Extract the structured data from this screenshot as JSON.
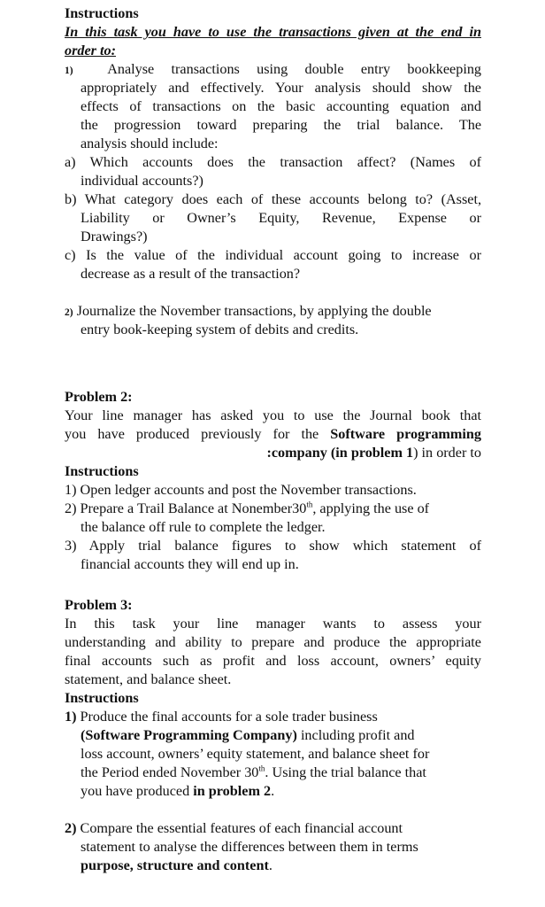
{
  "problem1": {
    "heading": "Instructions",
    "intro_line1": "In this task you have to use the transactions given at the end in",
    "intro_line2": "order to:",
    "item1": {
      "num": "1)",
      "lines": [
        "Analyse transactions using double entry bookkeeping",
        "appropriately and effectively. Your analysis should show the",
        "effects of transactions on the basic accounting equation and",
        "the progression toward preparing the trial balance. The",
        "analysis should include:"
      ]
    },
    "sub_a": [
      "a) Which accounts does the transaction affect? (Names of",
      "individual accounts?)"
    ],
    "sub_b": [
      "b) What category does each of these accounts belong to? (Asset,",
      "Liability or Owner’s Equity, Revenue, Expense or",
      "Drawings?)"
    ],
    "sub_c": [
      "c) Is the value of the individual account going to increase or",
      "decrease as a result of the transaction?"
    ],
    "item2": {
      "num": "2)",
      "lines": [
        "Journalize the November transactions, by applying the double",
        "entry book-keeping system of debits and credits."
      ]
    }
  },
  "problem2": {
    "heading": "Problem 2:",
    "para_line1": "Your line manager has asked you to use the Journal book that",
    "para_line2_pre": "you have produced previously for the ",
    "para_line2_bold": "Software programming",
    "para_line3_bold": ":company (in problem 1",
    "para_line3_post": ") in order to",
    "instructions_heading": "Instructions",
    "item1": "1) Open ledger accounts and post the November transactions.",
    "item2_pre": "2) Prepare a Trail Balance at Nonember30",
    "item2_sup": "th",
    "item2_post": ", applying the use of",
    "item2_line2": "the balance off rule to complete the ledger.",
    "item3_line1": "3) Apply trial balance figures to show which statement of",
    "item3_line2": "financial accounts they will end up in."
  },
  "problem3": {
    "heading": "Problem 3:",
    "para": [
      "In this task your line manager wants to assess your",
      "understanding and ability to prepare and produce the appropriate",
      "final accounts such as profit and loss account, owners’ equity",
      "statement, and balance sheet."
    ],
    "instructions_heading": "Instructions",
    "item1_num": "1)",
    "item1_line1": " Produce the final accounts for a sole trader business",
    "item1_line2_bold": "(Software Programming Company)",
    "item1_line2_post": " including profit and",
    "item1_line3": "loss account, owners’ equity statement, and balance sheet for",
    "item1_line4_pre": "the Period ended November 30",
    "item1_line4_sup": "th",
    "item1_line4_post": ". Using the trial balance that",
    "item1_line5_pre": "you have produced ",
    "item1_line5_bold": "in problem 2",
    "item1_line5_post": ".",
    "item2_num": "2)",
    "item2_line1": " Compare the essential features of each financial account",
    "item2_line2": "statement to analyse the differences between them in terms",
    "item2_line3_bold": "purpose, structure and content",
    "item2_line3_post": "."
  }
}
